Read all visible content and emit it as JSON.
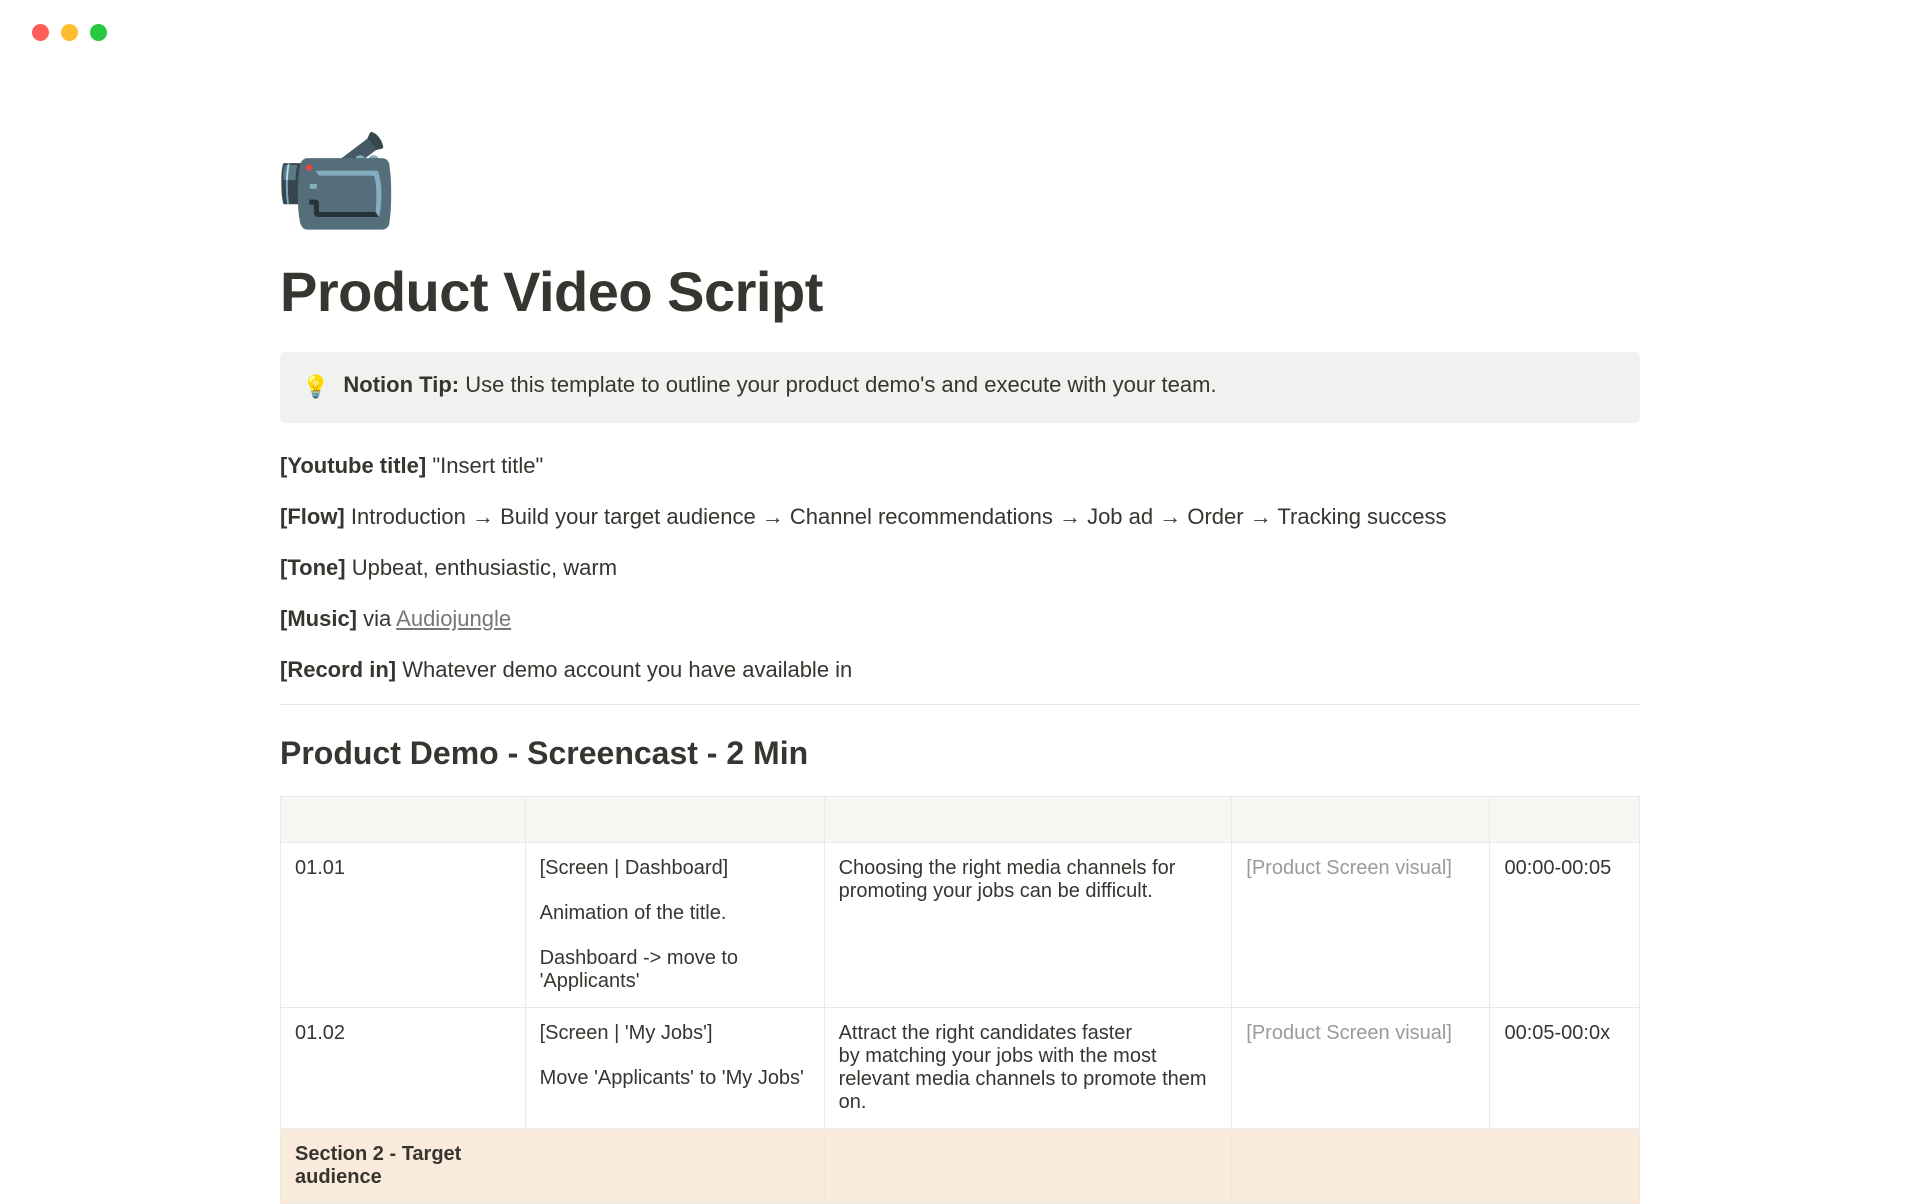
{
  "icon": "📹",
  "page_title": "Product Video Script",
  "callout": {
    "bulb": "💡",
    "label": "Notion Tip:",
    "text": "Use this template to outline your product demo's and execute with your team."
  },
  "meta": {
    "youtube_label": "[Youtube title]",
    "youtube_value": "\"Insert title\"",
    "flow_label": "[Flow]",
    "flow_value": "Introduction → Build your target audience → Channel recommendations → Job ad → Order → Tracking success",
    "tone_label": "[Tone]",
    "tone_value": "Upbeat, enthusiastic, warm",
    "music_label": "[Music]",
    "music_via": "via",
    "music_link": "Audiojungle",
    "record_label": "[Record in]",
    "record_value": "Whatever demo account you have available in"
  },
  "section_heading": "Product Demo - Screencast - 2 Min",
  "rows": {
    "r1": {
      "id": "01.01",
      "scene_a": "[Screen | Dashboard]",
      "scene_b": "Animation of the title.",
      "scene_c": "Dashboard -> move to 'Applicants'",
      "desc": "Choosing the right media channels for promoting your jobs can be difficult.",
      "visual": "[Product Screen visual]",
      "time": "00:00-00:05"
    },
    "r2": {
      "id": "01.02",
      "scene_a": "[Screen | 'My Jobs']",
      "scene_b": "Move 'Applicants' to 'My Jobs'",
      "desc_a": "Attract the right candidates faster",
      "desc_b": "by matching your jobs with the most relevant media channels to promote them on.",
      "visual": "[Product Screen visual]",
      "time": "00:05-00:0x"
    },
    "section2": "Section 2 - Target audience"
  }
}
